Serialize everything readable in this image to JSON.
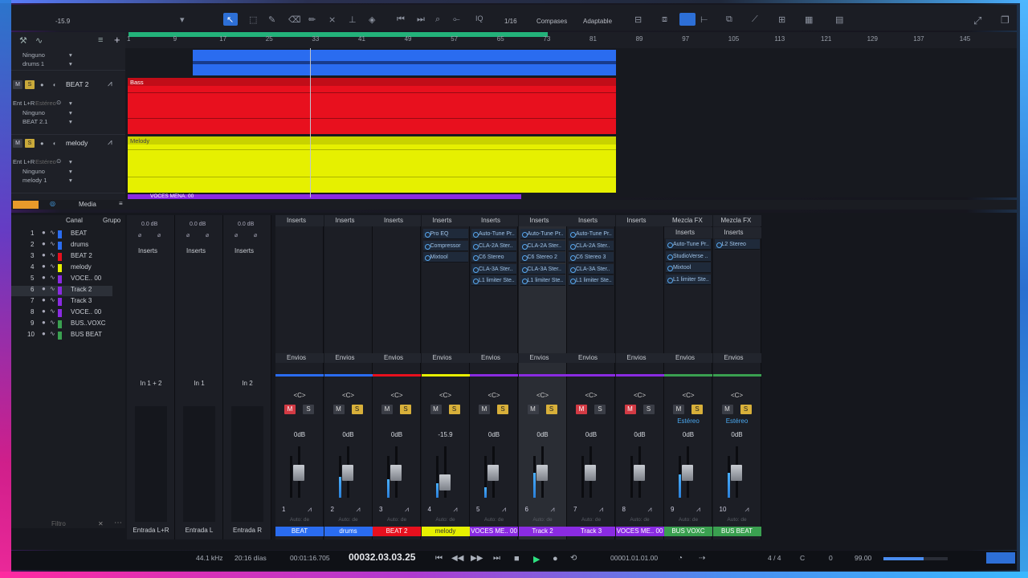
{
  "toolbar": {
    "value": "-15.9",
    "quantize": "1/16",
    "timebase": "Compases",
    "snap": "Adaptable"
  },
  "ruler": {
    "ticks": [
      "1",
      "9",
      "17",
      "25",
      "33",
      "41",
      "49",
      "57",
      "65",
      "73",
      "81",
      "89",
      "97",
      "105",
      "113",
      "121",
      "129",
      "137",
      "145"
    ]
  },
  "tracks": [
    {
      "name": "drums",
      "io1": "Ninguno",
      "io2": "drums 1",
      "clip": "",
      "color": "#2a6cf0"
    },
    {
      "name": "BEAT 2",
      "input": "Ent L+R",
      "input_tag": "Estéreo",
      "io1": "Ninguno",
      "io2": "BEAT 2.1",
      "clip": "Bass",
      "color": "#e8101e"
    },
    {
      "name": "melody",
      "input": "Ent L+R",
      "input_tag": "Estéreo",
      "io1": "Ninguno",
      "io2": "melody 1",
      "clip": "Melody",
      "color": "#e6f000"
    }
  ],
  "partial_clip": "VOCES MENA. 00",
  "browser_tab": "Media",
  "channel_list": {
    "header_canal": "Canal",
    "header_grupo": "Grupo",
    "rows": [
      {
        "n": "1",
        "name": "BEAT",
        "color": "#2a6cf0"
      },
      {
        "n": "2",
        "name": "drums",
        "color": "#2a6cf0"
      },
      {
        "n": "3",
        "name": "BEAT 2",
        "color": "#e8101e"
      },
      {
        "n": "4",
        "name": "melody",
        "color": "#e6f000"
      },
      {
        "n": "5",
        "name": "VOCE.. 00",
        "color": "#8a2be2"
      },
      {
        "n": "6",
        "name": "Track 2",
        "color": "#8a2be2"
      },
      {
        "n": "7",
        "name": "Track 3",
        "color": "#8a2be2"
      },
      {
        "n": "8",
        "name": "VOCE.. 00",
        "color": "#8a2be2"
      },
      {
        "n": "9",
        "name": "BUS..VOXC",
        "color": "#3aa050"
      },
      {
        "n": "10",
        "name": "BUS BEAT",
        "color": "#3aa050"
      }
    ],
    "filter": "Filtro"
  },
  "inputs": [
    {
      "db": "0.0 dB",
      "header": "Inserts",
      "label": "In 1 + 2",
      "name": "Entrada L+R"
    },
    {
      "db": "0.0 dB",
      "header": "Inserts",
      "label": "In 1",
      "name": "Entrada L"
    },
    {
      "db": "0.0 dB",
      "header": "Inserts",
      "label": "In 2",
      "name": "Entrada R"
    }
  ],
  "mixer_labels": {
    "inserts": "Inserts",
    "envios": "Envios",
    "mute": "M",
    "solo": "S",
    "pan": "<C>",
    "auto": "Auto: de",
    "fx_header": "Mezcla FX",
    "stereo": "Estéreo"
  },
  "strips": [
    {
      "num": "1",
      "name": "BEAT",
      "vol": "0dB",
      "color": "#2a6cf0",
      "inserts": [],
      "m_on": true,
      "s_on": false,
      "fader": 0.55,
      "meter": 0.0
    },
    {
      "num": "2",
      "name": "drums",
      "vol": "0dB",
      "color": "#2a6cf0",
      "inserts": [],
      "m_on": false,
      "s_on": true,
      "fader": 0.55,
      "meter": 0.5
    },
    {
      "num": "3",
      "name": "BEAT 2",
      "vol": "0dB",
      "color": "#e8101e",
      "inserts": [],
      "m_on": false,
      "s_on": true,
      "fader": 0.55,
      "meter": 0.45
    },
    {
      "num": "4",
      "name": "melody",
      "vol": "-15.9",
      "color": "#e6f000",
      "inserts": [
        "Pro EQ",
        "Compressor",
        "Mixtool"
      ],
      "m_on": false,
      "s_on": true,
      "fader": 0.3,
      "meter": 0.35
    },
    {
      "num": "5",
      "name": "VOCES ME.. 00",
      "vol": "0dB",
      "color": "#8a2be2",
      "inserts": [
        "Auto-Tune Pr..",
        "CLA-2A Ster..",
        "C6 Stereo",
        "CLA-3A Ster..",
        "L1 limiter Ste.."
      ],
      "m_on": false,
      "s_on": true,
      "fader": 0.55,
      "meter": 0.25
    },
    {
      "num": "6",
      "name": "Track 2",
      "vol": "0dB",
      "color": "#8a2be2",
      "inserts": [
        "Auto-Tune Pr..",
        "CLA-2A Ster..",
        "C6 Stereo 2",
        "CLA-3A Ster..",
        "L1 limiter Ste.."
      ],
      "m_on": false,
      "s_on": true,
      "fader": 0.55,
      "meter": 0.6
    },
    {
      "num": "7",
      "name": "Track 3",
      "vol": "0dB",
      "color": "#8a2be2",
      "inserts": [
        "Auto-Tune Pr..",
        "CLA-2A Ster..",
        "C6 Stereo 3",
        "CLA-3A Ster..",
        "L1 limiter Ste.."
      ],
      "m_on": true,
      "s_on": false,
      "fader": 0.55,
      "meter": 0.0
    },
    {
      "num": "8",
      "name": "VOCES ME.. 00",
      "vol": "0dB",
      "color": "#8a2be2",
      "inserts": [],
      "m_on": true,
      "s_on": false,
      "fader": 0.55,
      "meter": 0.0
    },
    {
      "num": "9",
      "name": "BUS VOXC",
      "vol": "0dB",
      "color": "#3aa050",
      "inserts": [
        "Auto-Tune Pr..",
        "StudioVerse ..",
        "Mixtool",
        "L1 limiter Ste.."
      ],
      "m_on": false,
      "s_on": true,
      "fader": 0.55,
      "meter": 0.55,
      "fx": true
    },
    {
      "num": "10",
      "name": "BUS BEAT",
      "vol": "0dB",
      "color": "#3aa050",
      "inserts": [
        "L2 Stereo"
      ],
      "m_on": false,
      "s_on": true,
      "fader": 0.55,
      "meter": 0.6,
      "fx": true
    }
  ],
  "transport": {
    "sample_rate": "44.1 kHz",
    "duration": "20:16 días",
    "time": "00:01:16.705",
    "bars": "00032.03.03.25",
    "loop_start": "00001.01.01.00",
    "signature": "4 / 4",
    "key": "C",
    "zero": "0",
    "tempo": "99.00"
  },
  "colors": {
    "accent": "#2d6fd6",
    "meter": "#4ab0ff"
  }
}
